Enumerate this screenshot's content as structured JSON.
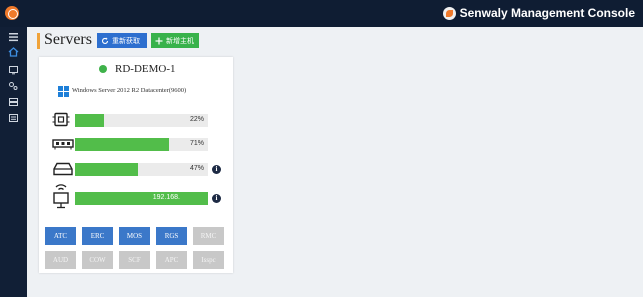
{
  "app": {
    "title": "Senwaly Management Console"
  },
  "sidebar": {
    "items": [
      "menu",
      "home",
      "monitor",
      "settings",
      "storage",
      "list"
    ]
  },
  "page": {
    "title": "Servers"
  },
  "toolbar": {
    "refresh_label": "重新获取",
    "new_label": "新增主机"
  },
  "server": {
    "name": "RD-DEMO-1",
    "status_color": "#3fb24a",
    "os": "Windows Server 2012 R2 Datacenter(9600)",
    "resources": [
      {
        "kind": "cpu",
        "percent": 22,
        "label": "22%",
        "info": false
      },
      {
        "kind": "memory",
        "percent": 71,
        "label": "71%",
        "info": false
      },
      {
        "kind": "disk",
        "percent": 47,
        "label": "47%",
        "info": true
      },
      {
        "kind": "network",
        "percent": 100,
        "label": "192.168.",
        "info": true
      }
    ],
    "actions": [
      {
        "label": "ATC",
        "enabled": true
      },
      {
        "label": "ERC",
        "enabled": true
      },
      {
        "label": "MOS",
        "enabled": true
      },
      {
        "label": "RGS",
        "enabled": true
      },
      {
        "label": "RMC",
        "enabled": false
      },
      {
        "label": "AUD",
        "enabled": false
      },
      {
        "label": "COW",
        "enabled": false
      },
      {
        "label": "SCF",
        "enabled": false
      },
      {
        "label": "APC",
        "enabled": false
      },
      {
        "label": "Isspc",
        "enabled": false
      }
    ]
  },
  "colors": {
    "accent": "#2d6fcf",
    "success": "#38b24b",
    "bar_fill": "#52bd4a",
    "topbar": "#0f1d33"
  }
}
